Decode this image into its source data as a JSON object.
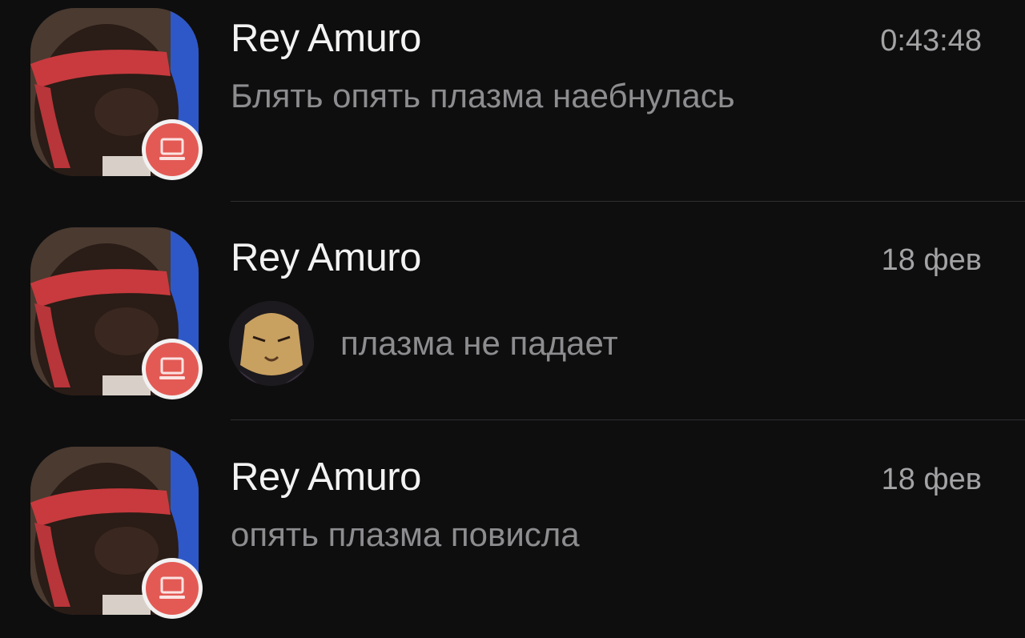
{
  "chats": [
    {
      "name": "Rey Amuro",
      "time": "0:43:48",
      "preview": "Блять опять плазма наебнулась",
      "avatar_icon": "profile-photo",
      "badge_icon": "laptop-icon"
    },
    {
      "name": "Rey Amuro",
      "time": "18 фев",
      "preview": "плазма не падает",
      "avatar_icon": "profile-photo",
      "badge_icon": "laptop-icon",
      "sender_avatar_icon": "anime-wolf-avatar"
    },
    {
      "name": "Rey Amuro",
      "time": "18 фев",
      "preview": "опять плазма повисла",
      "avatar_icon": "profile-photo",
      "badge_icon": "laptop-icon"
    }
  ],
  "colors": {
    "background": "#0e0e0f",
    "name": "#f3f3f3",
    "time": "#a3a3a5",
    "preview": "#8d8d90",
    "badge": "#e35a55",
    "divider": "#2f2f31"
  }
}
